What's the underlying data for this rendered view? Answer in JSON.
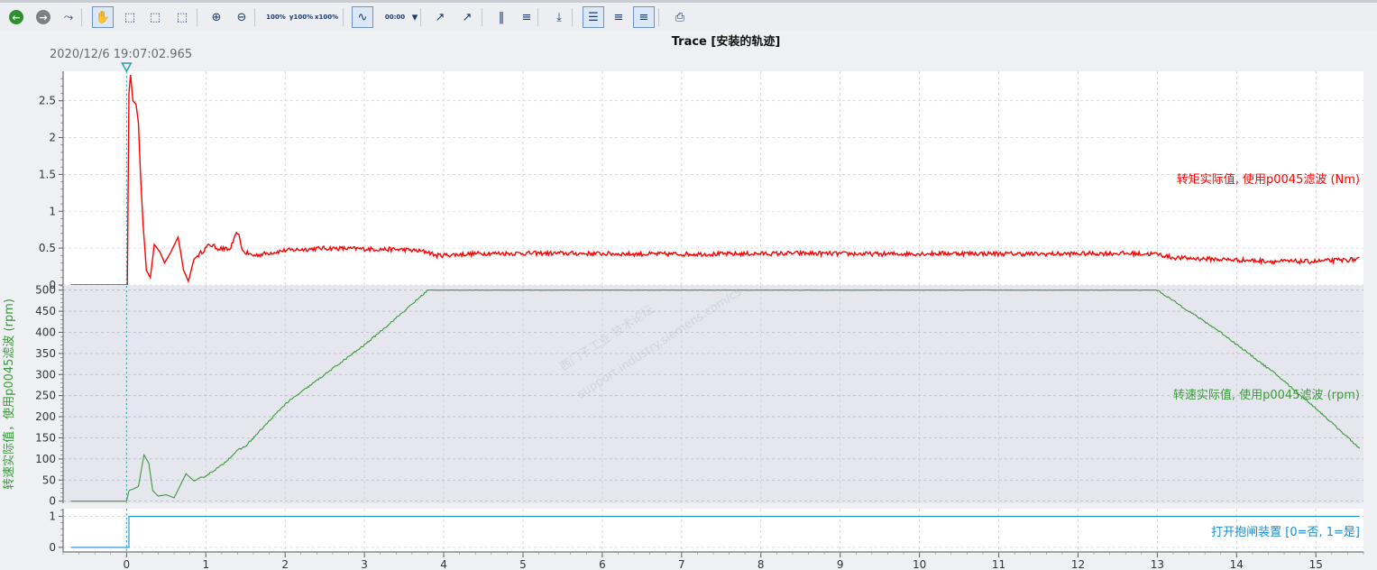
{
  "toolbar": {
    "buttons": [
      {
        "name": "back-icon",
        "glyph": "←"
      },
      {
        "name": "forward-icon",
        "glyph": "→"
      },
      {
        "name": "measure-icon",
        "glyph": "⤳"
      },
      {
        "name": "pan-hand-icon",
        "glyph": "✋",
        "active": true
      },
      {
        "name": "zoom-rect-icon",
        "glyph": "⬚"
      },
      {
        "name": "zoom-horizontal-icon",
        "glyph": "⬚"
      },
      {
        "name": "zoom-vertical-icon",
        "glyph": "⬚"
      },
      {
        "name": "zoom-in-icon",
        "glyph": "⊕"
      },
      {
        "name": "zoom-out-icon",
        "glyph": "⊖"
      },
      {
        "name": "zoom-100-icon",
        "glyph": "100%"
      },
      {
        "name": "y-100-icon",
        "glyph": "y100%"
      },
      {
        "name": "x-100-icon",
        "glyph": "x100%"
      },
      {
        "name": "overview-icon",
        "glyph": "∿",
        "active": true
      },
      {
        "name": "measure-point-icon",
        "glyph": "00:00"
      },
      {
        "name": "dropdown-icon",
        "glyph": "▾"
      },
      {
        "name": "curve-icon",
        "glyph": "↗"
      },
      {
        "name": "scale-icon",
        "glyph": "↗"
      },
      {
        "name": "vertical-cursor-icon",
        "glyph": "‖"
      },
      {
        "name": "horizontal-cursor-icon",
        "glyph": "≡"
      },
      {
        "name": "export-icon",
        "glyph": "⤓"
      },
      {
        "name": "signal-table-icon",
        "glyph": "☰",
        "active": true
      },
      {
        "name": "align-left-icon",
        "glyph": "≡"
      },
      {
        "name": "align-right-icon",
        "glyph": "≡",
        "active": true
      },
      {
        "name": "print-icon",
        "glyph": "⎙"
      }
    ]
  },
  "chart_title": "Trace [安装的轨迹]",
  "trigger_timestamp": "2020/12/6 19:07:02.965",
  "watermark": {
    "line1": "西门子工业 技术论坛",
    "line2": "support.industry.siemens.com/cs"
  },
  "colors": {
    "torque": "#ff0000",
    "speed": "#3a9a3a",
    "brake": "#1a8ed0",
    "trigger": "#2aa0b0"
  },
  "chart_data": {
    "type": "line",
    "x_ticks": [
      0,
      1,
      2,
      3,
      4,
      5,
      6,
      7,
      8,
      9,
      10,
      11,
      12,
      13,
      14,
      15
    ],
    "xlim": [
      -0.8,
      15.6
    ],
    "trigger_x": 0,
    "panels": [
      {
        "name": "torque",
        "series_name": "转矩实际值, 使用p0045滤波 (Nm)",
        "ylim": [
          0,
          2.9
        ],
        "y_ticks": [
          0,
          0.5,
          1,
          1.5,
          2,
          2.5
        ],
        "y_tick_labels": [
          "0",
          "0.5",
          "1",
          "1.5",
          "2",
          "2.5"
        ],
        "points": [
          [
            -0.7,
            0
          ],
          [
            -0.02,
            0
          ],
          [
            0.01,
            0
          ],
          [
            0.03,
            2.6
          ],
          [
            0.05,
            2.85
          ],
          [
            0.08,
            2.5
          ],
          [
            0.12,
            2.45
          ],
          [
            0.15,
            2.2
          ],
          [
            0.18,
            1.4
          ],
          [
            0.21,
            0.8
          ],
          [
            0.25,
            0.2
          ],
          [
            0.3,
            0.1
          ],
          [
            0.35,
            0.55
          ],
          [
            0.42,
            0.45
          ],
          [
            0.48,
            0.3
          ],
          [
            0.56,
            0.45
          ],
          [
            0.65,
            0.65
          ],
          [
            0.72,
            0.2
          ],
          [
            0.78,
            0.05
          ],
          [
            0.85,
            0.35
          ],
          [
            0.95,
            0.45
          ],
          [
            1.05,
            0.55
          ],
          [
            1.15,
            0.5
          ],
          [
            1.3,
            0.48
          ],
          [
            1.4,
            0.72
          ],
          [
            1.47,
            0.45
          ],
          [
            1.6,
            0.4
          ],
          [
            2.0,
            0.47
          ],
          [
            2.5,
            0.5
          ],
          [
            3.0,
            0.49
          ],
          [
            3.5,
            0.48
          ],
          [
            3.8,
            0.45
          ],
          [
            3.9,
            0.4
          ],
          [
            4.5,
            0.43
          ],
          [
            5.5,
            0.43
          ],
          [
            6.5,
            0.42
          ],
          [
            7.5,
            0.42
          ],
          [
            8.5,
            0.43
          ],
          [
            9.5,
            0.42
          ],
          [
            10.5,
            0.43
          ],
          [
            11.5,
            0.42
          ],
          [
            12.5,
            0.43
          ],
          [
            13.0,
            0.42
          ],
          [
            13.2,
            0.37
          ],
          [
            14.0,
            0.34
          ],
          [
            14.5,
            0.32
          ],
          [
            15.0,
            0.32
          ],
          [
            15.55,
            0.35
          ]
        ],
        "noise": 0.03
      },
      {
        "name": "speed",
        "series_name": "转速实际值, 使用p0045滤波 (rpm)",
        "y_axis_label": "转速实际值，使用p0045滤波 (rpm)",
        "ylim": [
          -5,
          510
        ],
        "y_ticks": [
          0,
          50,
          100,
          150,
          200,
          250,
          300,
          350,
          400,
          450,
          500
        ],
        "y_tick_labels": [
          "0",
          "50",
          "100",
          "150",
          "200",
          "250",
          "300",
          "350",
          "400",
          "450",
          "500"
        ],
        "points": [
          [
            -0.7,
            0
          ],
          [
            0.0,
            0
          ],
          [
            0.03,
            25
          ],
          [
            0.1,
            30
          ],
          [
            0.15,
            35
          ],
          [
            0.22,
            110
          ],
          [
            0.28,
            90
          ],
          [
            0.33,
            25
          ],
          [
            0.4,
            12
          ],
          [
            0.5,
            15
          ],
          [
            0.6,
            8
          ],
          [
            0.75,
            65
          ],
          [
            0.85,
            48
          ],
          [
            1.0,
            60
          ],
          [
            1.2,
            85
          ],
          [
            1.4,
            120
          ],
          [
            1.5,
            130
          ],
          [
            2.0,
            230
          ],
          [
            2.5,
            300
          ],
          [
            3.0,
            370
          ],
          [
            3.5,
            450
          ],
          [
            3.8,
            500
          ],
          [
            4.0,
            500
          ],
          [
            6.0,
            500
          ],
          [
            8.0,
            500
          ],
          [
            10.0,
            500
          ],
          [
            12.0,
            500
          ],
          [
            13.0,
            500
          ],
          [
            13.8,
            400
          ],
          [
            14.5,
            300
          ],
          [
            15.0,
            220
          ],
          [
            15.35,
            160
          ],
          [
            15.55,
            125
          ]
        ],
        "noise": 2
      },
      {
        "name": "brake",
        "series_name": "打开抱闸装置 [0=否, 1=是]",
        "ylim": [
          -0.15,
          1.25
        ],
        "y_ticks": [
          0,
          1
        ],
        "y_tick_labels": [
          "0",
          "1"
        ],
        "points": [
          [
            -0.7,
            0
          ],
          [
            0.03,
            0
          ],
          [
            0.03,
            1
          ],
          [
            15.55,
            1
          ]
        ],
        "noise": 0
      }
    ]
  }
}
